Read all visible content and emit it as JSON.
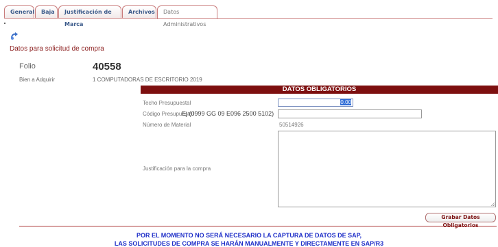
{
  "tabs": [
    {
      "label": "General"
    },
    {
      "label": "Baja"
    },
    {
      "label": "Justificación de Marca"
    },
    {
      "label": "Archivos"
    },
    {
      "label": "Datos Administrativos"
    }
  ],
  "section_title": "Datos para solicitud de compra",
  "folio": {
    "label": "Folio",
    "value": "40558"
  },
  "bien": {
    "label": "Bien a Adquirir",
    "value": "1 COMPUTADORAS DE ESCRITORIO 2019"
  },
  "obligatorios": {
    "header": "DATOS OBLIGATORIOS",
    "techo_label": "Techo Presupuestal",
    "techo_value": "0.00",
    "codigo_label": "Código Presupuestal",
    "codigo_hint": "Ej (0999 GG 09 E096 2500 5102)",
    "material_label": "Número de Material",
    "material_value": "50514926",
    "justificacion_label": "Justificación para la compra",
    "save_label": "Grabar Datos Obligatorios"
  },
  "notice": {
    "line1": "POR EL MOMENTO NO SERÁ NECESARIO LA CAPTURA DE DATOS DE SAP,",
    "line2": "LAS SOLICITUDES DE COMPRA SE HARÁN MANUALMENTE Y DIRECTAMENTE EN SAP/R3"
  },
  "colors": {
    "accent": "#7d0f0f",
    "link": "#3b5a8a",
    "notice": "#1f2fc8"
  },
  "icons": {
    "top": "recycle-arrow-icon"
  }
}
